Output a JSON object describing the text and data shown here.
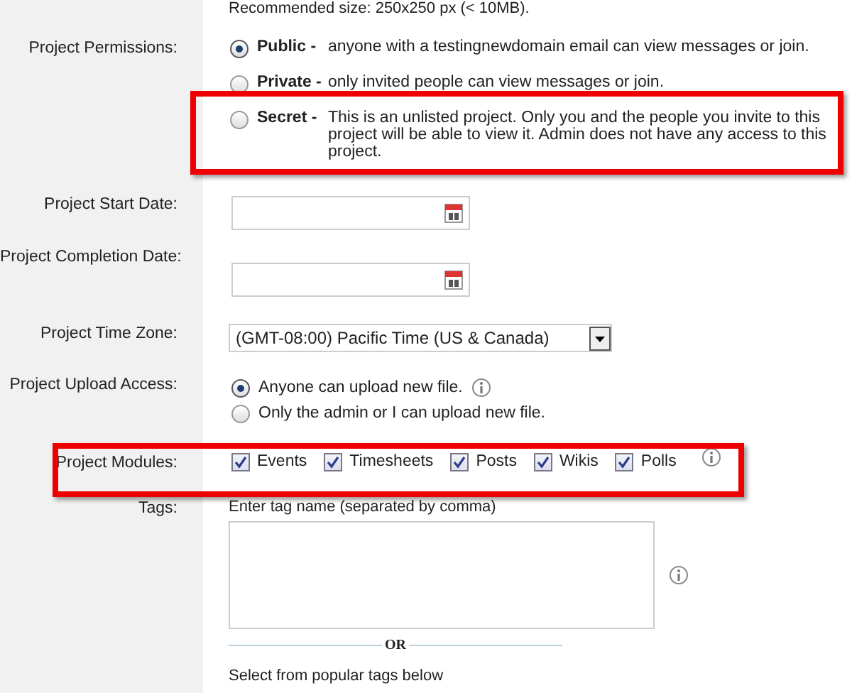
{
  "upload_note": "Recommended size: 250x250 px (< 10MB).",
  "permissions": {
    "label": "Project Permissions:",
    "options": [
      {
        "title": "Public -",
        "description": "anyone with a testingnewdomain email can view messages or join.",
        "selected": true,
        "highlighted": false
      },
      {
        "title": "Private -",
        "description": "only invited people can view messages or join.",
        "selected": false,
        "highlighted": false
      },
      {
        "title": "Secret -",
        "description": "This is an unlisted project. Only you and the people you invite to this project will be able to view it. Admin does not have any access to this project.",
        "selected": false,
        "highlighted": true
      }
    ]
  },
  "start_date": {
    "label": "Project Start Date:"
  },
  "completion_date": {
    "label": "Project Completion Date:"
  },
  "time_zone": {
    "label": "Project Time Zone:",
    "value": "(GMT-08:00) Pacific Time (US & Canada)"
  },
  "upload_access": {
    "label": "Project Upload Access:",
    "options": [
      {
        "text": "Anyone can upload new file.",
        "selected": true,
        "info": true
      },
      {
        "text": "Only the admin or I can upload new file.",
        "selected": false,
        "info": false
      }
    ]
  },
  "modules": {
    "label": "Project Modules:",
    "highlighted": true,
    "items": [
      {
        "label": "Events",
        "checked": true
      },
      {
        "label": "Timesheets",
        "checked": true
      },
      {
        "label": "Posts",
        "checked": true
      },
      {
        "label": "Wikis",
        "checked": true
      },
      {
        "label": "Polls",
        "checked": true
      }
    ]
  },
  "tags": {
    "label": "Tags:",
    "hint": "Enter tag name (separated by comma)",
    "separator": "OR",
    "popular_note": "Select from popular tags below"
  }
}
